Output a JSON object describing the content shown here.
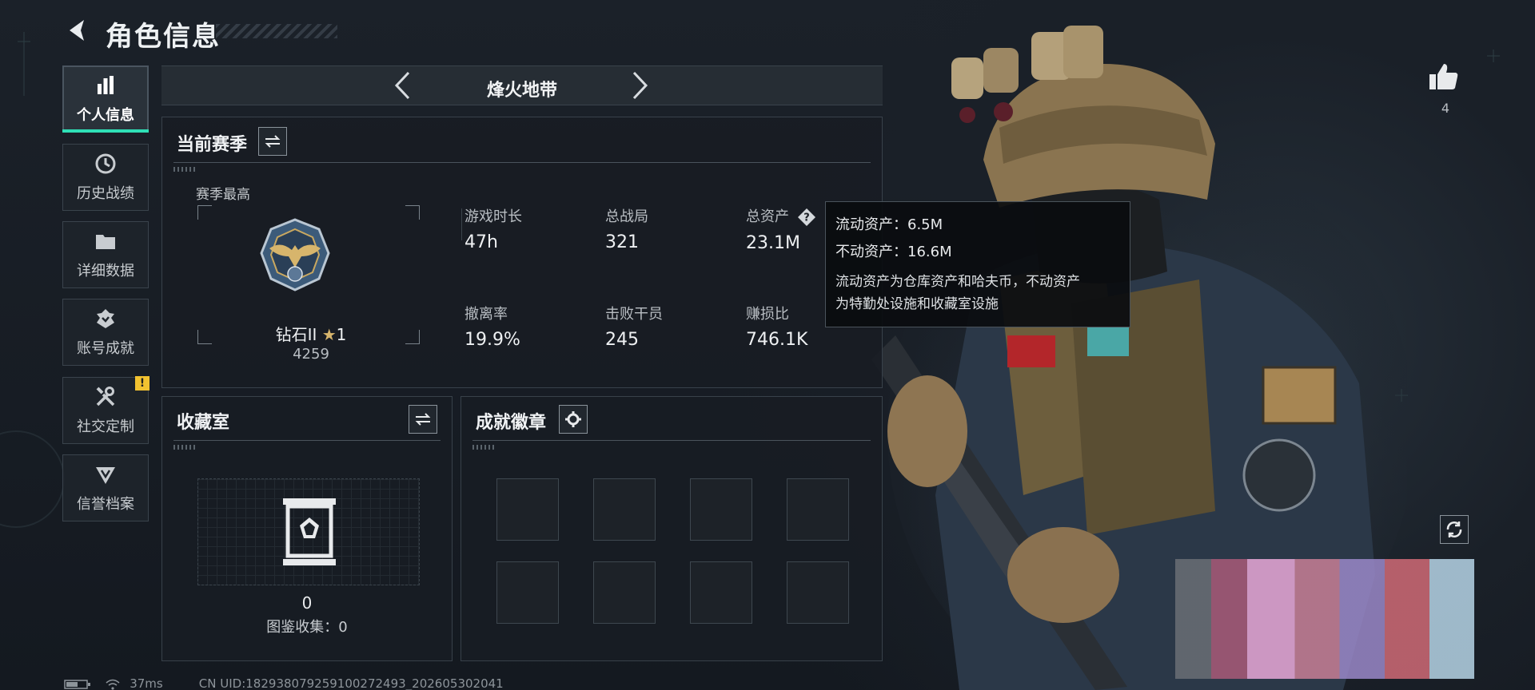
{
  "header": {
    "title": "角色信息"
  },
  "sidebar": {
    "items": [
      {
        "label": "个人信息",
        "icon": "bar-chart-icon",
        "active": true
      },
      {
        "label": "历史战绩",
        "icon": "history-clock-icon"
      },
      {
        "label": "详细数据",
        "icon": "folder-icon"
      },
      {
        "label": "账号成就",
        "icon": "achievement-icon"
      },
      {
        "label": "社交定制",
        "icon": "tools-icon",
        "badge": "!"
      },
      {
        "label": "信誉档案",
        "icon": "reputation-icon"
      }
    ]
  },
  "mode": {
    "name": "烽火地带"
  },
  "season": {
    "title": "当前赛季",
    "best_label": "赛季最高",
    "rank_name": "钻石II",
    "rank_stars": "1",
    "rank_points": "4259",
    "stats": [
      {
        "label": "游戏时长",
        "value": "47h"
      },
      {
        "label": "总战局",
        "value": "321"
      },
      {
        "label": "总资产",
        "value": "23.1M"
      },
      {
        "label": "撤离率",
        "value": "19.9%"
      },
      {
        "label": "击败干员",
        "value": "245"
      },
      {
        "label": "赚损比",
        "value": "746.1K"
      }
    ]
  },
  "tooltip": {
    "liquid": "流动资产：6.5M",
    "fixed": "不动资产：16.6M",
    "desc_line1": "流动资产为仓库资产和哈夫币，不动资产",
    "desc_line2": "为特勤处设施和收藏室设施"
  },
  "collection": {
    "title": "收藏室",
    "count": "0",
    "codex": "图鉴收集：0"
  },
  "achievements": {
    "title": "成就徽章"
  },
  "like": {
    "count": "4"
  },
  "status": {
    "ping": "37ms",
    "uid": "CN UID:182938079259100272493_202605302041"
  },
  "colors": {
    "accent": "#2fe0b6",
    "warning": "#f2c230",
    "background": "#161b22"
  }
}
